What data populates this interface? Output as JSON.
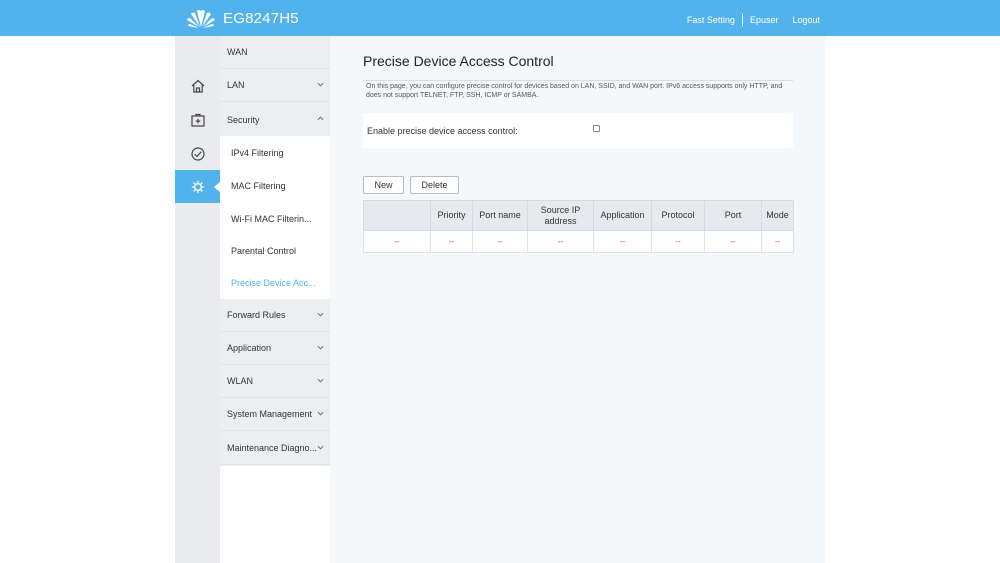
{
  "header": {
    "model": "EG8247H5",
    "links": {
      "fast_setting": "Fast Setting",
      "user": "Epuser",
      "logout": "Logout"
    },
    "color": "#52b3ec"
  },
  "rail": {
    "items": [
      {
        "icon": "home-icon"
      },
      {
        "icon": "toolbox-icon"
      },
      {
        "icon": "gauge-icon"
      },
      {
        "icon": "gear-icon",
        "active": true
      }
    ]
  },
  "menu": {
    "wan": "WAN",
    "lan": "LAN",
    "security": "Security",
    "security_items": [
      "IPv4 Filtering",
      "MAC Filtering",
      "Wi-Fi MAC Filterin...",
      "Parental Control",
      "Precise Device Acc..."
    ],
    "forward_rules": "Forward Rules",
    "application": "Application",
    "wlan": "WLAN",
    "system_management": "System Management",
    "maintenance": "Maintenance Diagno..."
  },
  "page": {
    "title": "Precise Device Access Control",
    "description": "On this page, you can configure precise control for devices based on LAN, SSID, and WAN port. IPv6 access supports only HTTP, and does not support TELNET, FTP, SSH, ICMP or SAMBA.",
    "enable_label": "Enable precise device access control:",
    "enable_checked": false,
    "buttons": {
      "new": "New",
      "delete": "Delete"
    },
    "table": {
      "headers": [
        "",
        "Priority",
        "Port name",
        "Source IP address",
        "Application",
        "Protocol",
        "Port",
        "Mode"
      ],
      "rows": [
        [
          "--",
          "--",
          "--",
          "--",
          "--",
          "--",
          "--",
          "--"
        ]
      ]
    }
  }
}
